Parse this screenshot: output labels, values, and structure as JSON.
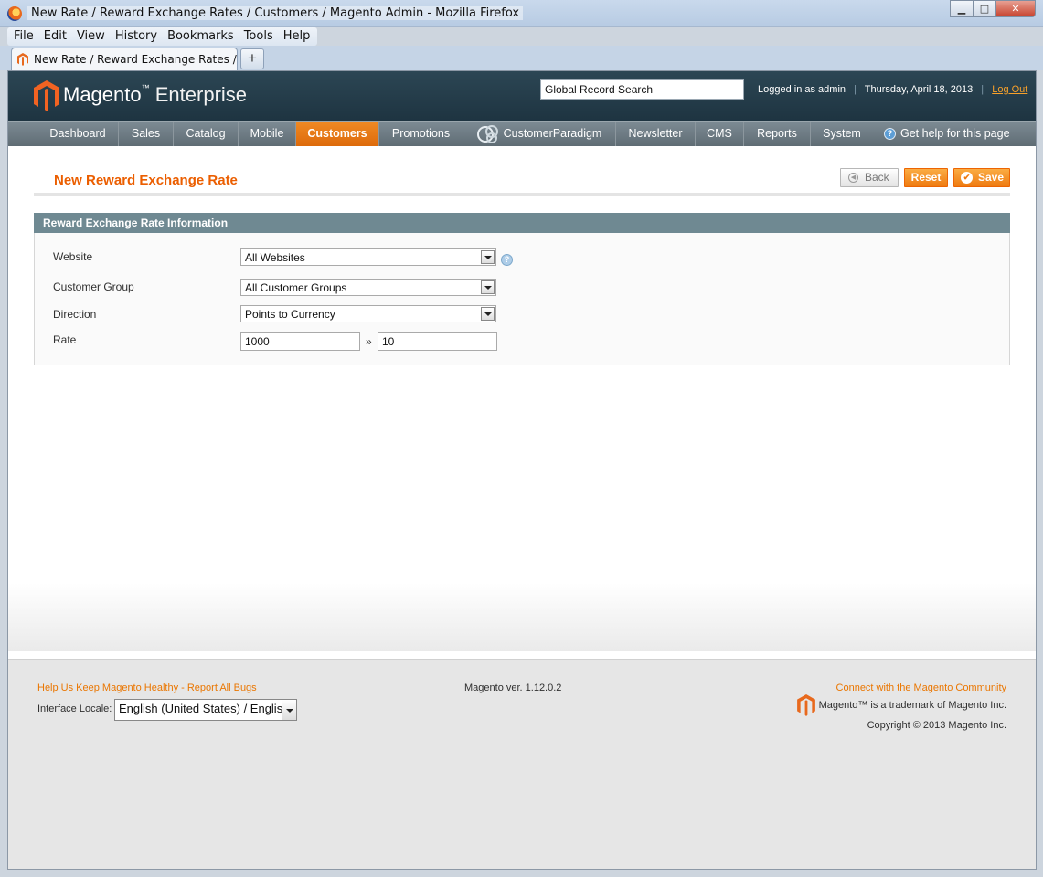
{
  "window": {
    "title": "New Rate / Reward Exchange Rates / Customers / Magento Admin - Mozilla Firefox",
    "minimize": "▁",
    "maximize": "□",
    "close": "✕"
  },
  "menubar": [
    "File",
    "Edit",
    "View",
    "History",
    "Bookmarks",
    "Tools",
    "Help"
  ],
  "tab": {
    "label": "New Rate / Reward Exchange Rates / Cu...",
    "new_tab": "+"
  },
  "header": {
    "logo_brand": "Magento",
    "logo_edition": "Enterprise",
    "search_value": "Global Record Search",
    "logged_in": "Logged in as admin",
    "date": "Thursday, April 18, 2013",
    "separator": "|",
    "logout": "Log Out"
  },
  "nav": {
    "items": [
      "Dashboard",
      "Sales",
      "Catalog",
      "Mobile",
      "Customers",
      "Promotions",
      "CustomerParadigm",
      "Newsletter",
      "CMS",
      "Reports",
      "System"
    ],
    "active": "Customers",
    "help": "Get help for this page"
  },
  "page": {
    "title": "New Reward Exchange Rate",
    "buttons": {
      "back": "Back",
      "reset": "Reset",
      "save": "Save"
    }
  },
  "form": {
    "section_title": "Reward Exchange Rate Information",
    "website_label": "Website",
    "website_value": "All Websites",
    "group_label": "Customer Group",
    "group_value": "All Customer Groups",
    "direction_label": "Direction",
    "direction_value": "Points to Currency",
    "rate_label": "Rate",
    "rate_from": "1000",
    "rate_separator": "»",
    "rate_to": "10"
  },
  "footer": {
    "bug_link": "Help Us Keep Magento Healthy - Report All Bugs",
    "version": "Magento ver. 1.12.0.2",
    "community_link": "Connect with the Magento Community",
    "trademark": "Magento™ is a trademark of Magento Inc.",
    "copyright": "Copyright © 2013 Magento Inc.",
    "locale_label": "Interface Locale:",
    "locale_value": "English (United States) / English"
  },
  "colors": {
    "accent": "#eb5e00",
    "header": "#1e3441",
    "nav": "#6c7981",
    "fieldset_head": "#6f8992"
  }
}
